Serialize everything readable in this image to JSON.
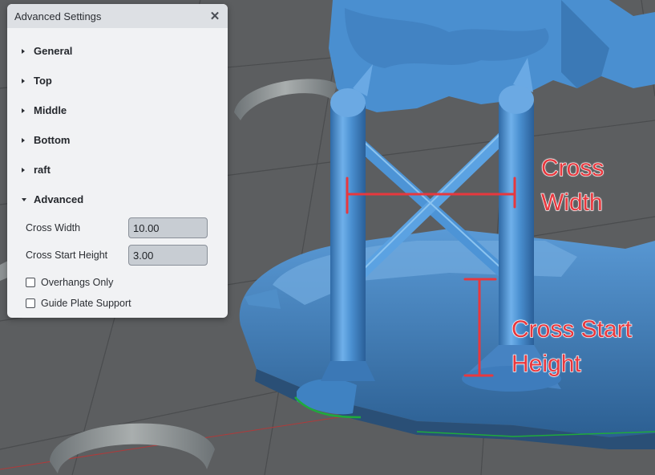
{
  "panel": {
    "title": "Advanced Settings",
    "close_symbol": "✕",
    "sections": [
      {
        "label": "General",
        "expanded": false
      },
      {
        "label": "Top",
        "expanded": false
      },
      {
        "label": "Middle",
        "expanded": false
      },
      {
        "label": "Bottom",
        "expanded": false
      },
      {
        "label": "raft",
        "expanded": false
      },
      {
        "label": "Advanced",
        "expanded": true
      }
    ],
    "fields": [
      {
        "label": "Cross Width",
        "value": "10.00"
      },
      {
        "label": "Cross Start Height",
        "value": "3.00"
      }
    ],
    "checkboxes": [
      {
        "label": "Overhangs Only",
        "checked": false
      },
      {
        "label": "Guide Plate Support",
        "checked": false
      }
    ]
  },
  "annotations": {
    "cross_width_line1": "Cross",
    "cross_width_line2": "Width",
    "cross_start_line1": "Cross Start",
    "cross_start_line2": "Height"
  },
  "colors": {
    "model": "#4a8fd0",
    "annotation": "#e7383e",
    "floor": "#5a5c5e"
  }
}
